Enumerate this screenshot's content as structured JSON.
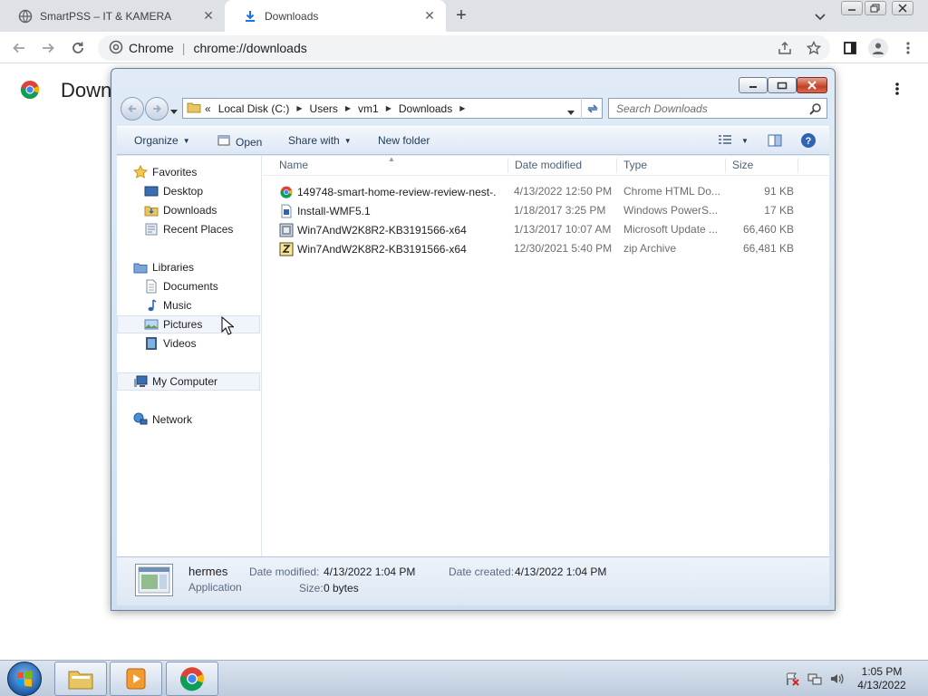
{
  "browser": {
    "tabs": [
      {
        "title": "SmartPSS – IT & KAMERA",
        "icon": "globe-icon",
        "active": false
      },
      {
        "title": "Downloads",
        "icon": "download-icon",
        "active": true
      }
    ],
    "omnibox": {
      "site": "Chrome",
      "url": "chrome://downloads"
    }
  },
  "downloads_page": {
    "title": "Downloads"
  },
  "explorer": {
    "address": {
      "overflow": "«",
      "crumbs": [
        "Local Disk (C:)",
        "Users",
        "vm1",
        "Downloads"
      ]
    },
    "search_placeholder": "Search Downloads",
    "commands": {
      "organize": "Organize",
      "open": "Open",
      "share_with": "Share with",
      "new_folder": "New folder"
    },
    "nav": {
      "favorites": "Favorites",
      "favorites_items": [
        "Desktop",
        "Downloads",
        "Recent Places"
      ],
      "libraries": "Libraries",
      "libraries_items": [
        "Documents",
        "Music",
        "Pictures",
        "Videos"
      ],
      "computer": "My Computer",
      "network": "Network"
    },
    "columns": {
      "name": "Name",
      "date": "Date modified",
      "type": "Type",
      "size": "Size"
    },
    "files": [
      {
        "name": "149748-smart-home-review-review-nest-...",
        "date": "4/13/2022 12:50 PM",
        "type": "Chrome HTML Do...",
        "size": "91 KB",
        "icon": "chrome-html-icon"
      },
      {
        "name": "Install-WMF5.1",
        "date": "1/18/2017 3:25 PM",
        "type": "Windows PowerS...",
        "size": "17 KB",
        "icon": "powershell-script-icon"
      },
      {
        "name": "Win7AndW2K8R2-KB3191566-x64",
        "date": "1/13/2017 10:07 AM",
        "type": "Microsoft Update ...",
        "size": "66,460 KB",
        "icon": "update-package-icon"
      },
      {
        "name": "Win7AndW2K8R2-KB3191566-x64",
        "date": "12/30/2021 5:40 PM",
        "type": "zip Archive",
        "size": "66,481 KB",
        "icon": "zip-archive-icon"
      }
    ],
    "details": {
      "name": "hermes",
      "kind": "Application",
      "modified_label": "Date modified:",
      "modified_value": "4/13/2022 1:04 PM",
      "created_label": "Date created:",
      "created_value": "4/13/2022 1:04 PM",
      "size_label": "Size:",
      "size_value": "0 bytes"
    }
  },
  "taskbar": {
    "clock_time": "1:05 PM",
    "clock_date": "4/13/2022"
  },
  "colors": {
    "chrome_tabstrip": "#dee1e6",
    "win7_frame": "#cfdff0",
    "close_red": "#c44026"
  }
}
